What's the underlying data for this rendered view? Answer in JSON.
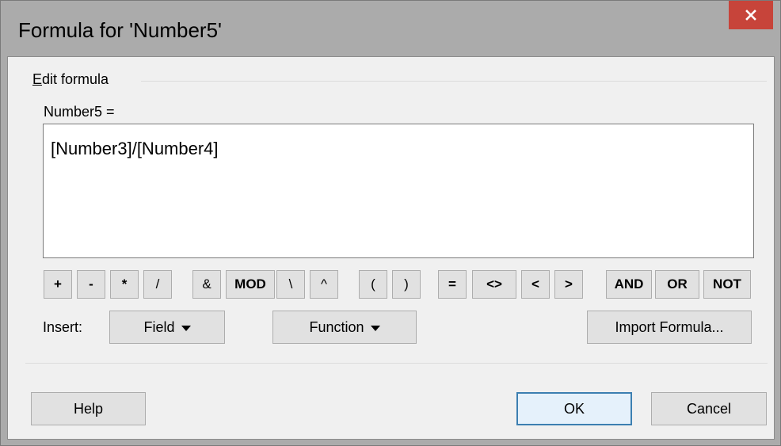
{
  "window": {
    "title": "Formula for 'Number5'",
    "close_icon": "close-icon"
  },
  "edit_formula": {
    "group_label_first": "E",
    "group_label_rest": "dit formula",
    "formula_label": "Number5 =",
    "formula_value": "[Number3]/[Number4]"
  },
  "operators": [
    {
      "label": "+",
      "name": "plus"
    },
    {
      "label": "-",
      "name": "minus"
    },
    {
      "label": "*",
      "name": "multiply"
    },
    {
      "label": "/",
      "name": "divide"
    },
    {
      "label": "&",
      "name": "concatenate"
    },
    {
      "label": "MOD",
      "name": "mod"
    },
    {
      "label": "\\",
      "name": "integer-divide"
    },
    {
      "label": "^",
      "name": "exponent"
    },
    {
      "label": "(",
      "name": "open-paren"
    },
    {
      "label": ")",
      "name": "close-paren"
    },
    {
      "label": "=",
      "name": "equals"
    },
    {
      "label": "<>",
      "name": "not-equal"
    },
    {
      "label": "<",
      "name": "less-than"
    },
    {
      "label": ">",
      "name": "greater-than"
    },
    {
      "label": "AND",
      "name": "and"
    },
    {
      "label": "OR",
      "name": "or"
    },
    {
      "label": "NOT",
      "name": "not"
    }
  ],
  "insert": {
    "label": "Insert:",
    "field_label": "Field",
    "function_label": "Function",
    "import_label": "Import Formula..."
  },
  "footer": {
    "help_label": "Help",
    "ok_label": "OK",
    "cancel_label": "Cancel"
  },
  "colors": {
    "close_button": "#c7443a",
    "default_button_border": "#3c7fb1"
  }
}
